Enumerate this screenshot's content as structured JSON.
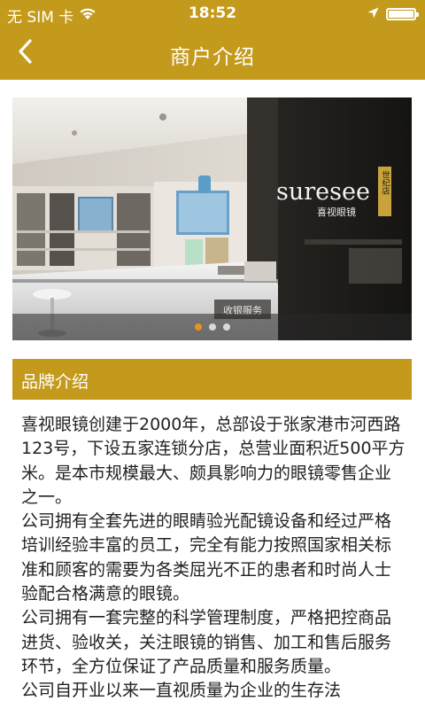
{
  "status_bar": {
    "carrier": "无 SIM 卡",
    "wifi_icon": "wifi-icon",
    "time": "18:52",
    "location_icon": "location-arrow-icon",
    "battery_icon": "battery-full-icon"
  },
  "nav": {
    "back_icon": "chevron-left-icon",
    "title": "商户介绍"
  },
  "banner": {
    "store_brand": "suresee",
    "store_brand_cn": "喜视眼镜",
    "branch_label": "世纪店",
    "counter_sign": "收银服务",
    "slide_count": 3,
    "active_slide": 1
  },
  "section": {
    "title": "品牌介绍"
  },
  "intro": {
    "paragraphs": [
      "喜视眼镜创建于2000年，总部设于张家港市河西路123号，下设五家连锁分店，总营业面积近500平方米。是本市规模最大、颇具影响力的眼镜零售企业之一。",
      "公司拥有全套先进的眼睛验光配镜设备和经过严格培训经验丰富的员工，完全有能力按照国家相关标准和顾客的需要为各类屈光不正的患者和时尚人士验配合格满意的眼镜。",
      "公司拥有一套完整的科学管理制度，严格把控商品进货、验收关，关注眼镜的销售、加工和售后服务环节，全方位保证了产品质量和服务质量。",
      "公司自开业以来一直视质量为企业的生存法"
    ]
  },
  "colors": {
    "brand_gold": "#c49a1c",
    "active_dot": "#e8941c",
    "body_text": "#222222"
  }
}
